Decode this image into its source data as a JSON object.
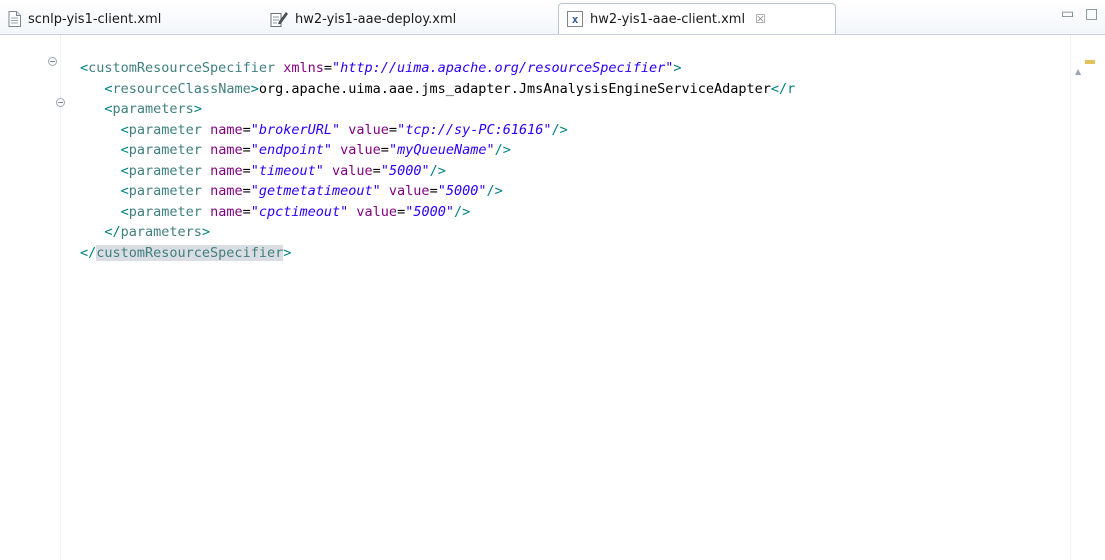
{
  "tabs": [
    {
      "label": "scnlp-yis1-client.xml",
      "icon": "text-file-icon",
      "active": false
    },
    {
      "label": "hw2-yis1-aae-deploy.xml",
      "icon": "edit-file-icon",
      "active": false
    },
    {
      "label": "hw2-yis1-aae-client.xml",
      "icon": "xml-file-icon",
      "active": true,
      "close": "☒"
    }
  ],
  "window_controls": {
    "minimize": "▭",
    "maximize": "□"
  },
  "editor": {
    "lines": [
      {
        "indent": "",
        "open": "<",
        "name": "customResourceSpecifier",
        "attrs": [
          {
            "name": "xmlns",
            "value": "\"http://uima.apache.org/resourceSpecifier\""
          }
        ],
        "close": ">"
      },
      {
        "indent": "   ",
        "open": "<",
        "name": "resourceClassName",
        "close": ">",
        "text": "org.apache.uima.aae.jms_adapter.JmsAnalysisEngineServiceAdapter",
        "tail": "</r"
      },
      {
        "indent": "   ",
        "open": "<",
        "name": "parameters",
        "close": ">"
      },
      {
        "indent": "     ",
        "open": "<",
        "name": "parameter",
        "attrs": [
          {
            "name": "name",
            "value": "\"brokerURL\""
          },
          {
            "name": "value",
            "value": "\"tcp://sy-PC:61616\""
          }
        ],
        "close": "/>"
      },
      {
        "indent": "     ",
        "open": "<",
        "name": "parameter",
        "attrs": [
          {
            "name": "name",
            "value": "\"endpoint\""
          },
          {
            "name": "value",
            "value": "\"myQueueName\""
          }
        ],
        "close": "/>"
      },
      {
        "indent": "     ",
        "open": "<",
        "name": "parameter",
        "attrs": [
          {
            "name": "name",
            "value": "\"timeout\""
          },
          {
            "name": "value",
            "value": "\"5000\""
          }
        ],
        "close": "/>"
      },
      {
        "indent": "     ",
        "open": "<",
        "name": "parameter",
        "attrs": [
          {
            "name": "name",
            "value": "\"getmetatimeout\""
          },
          {
            "name": "value",
            "value": "\"5000\""
          }
        ],
        "close": "/>"
      },
      {
        "indent": "     ",
        "open": "<",
        "name": "parameter",
        "attrs": [
          {
            "name": "name",
            "value": "\"cpctimeout\""
          },
          {
            "name": "value",
            "value": "\"5000\""
          }
        ],
        "close": "/>"
      },
      {
        "indent": "   ",
        "open": "</",
        "name": "parameters",
        "close": ">"
      },
      {
        "indent": "",
        "open": "</",
        "name": "customResourceSpecifier",
        "close": ">",
        "highlight": true
      }
    ]
  },
  "colors": {
    "tag": "#3f7f7f",
    "attribute": "#7f007f",
    "value": "#2a00ff",
    "text": "#000000"
  }
}
